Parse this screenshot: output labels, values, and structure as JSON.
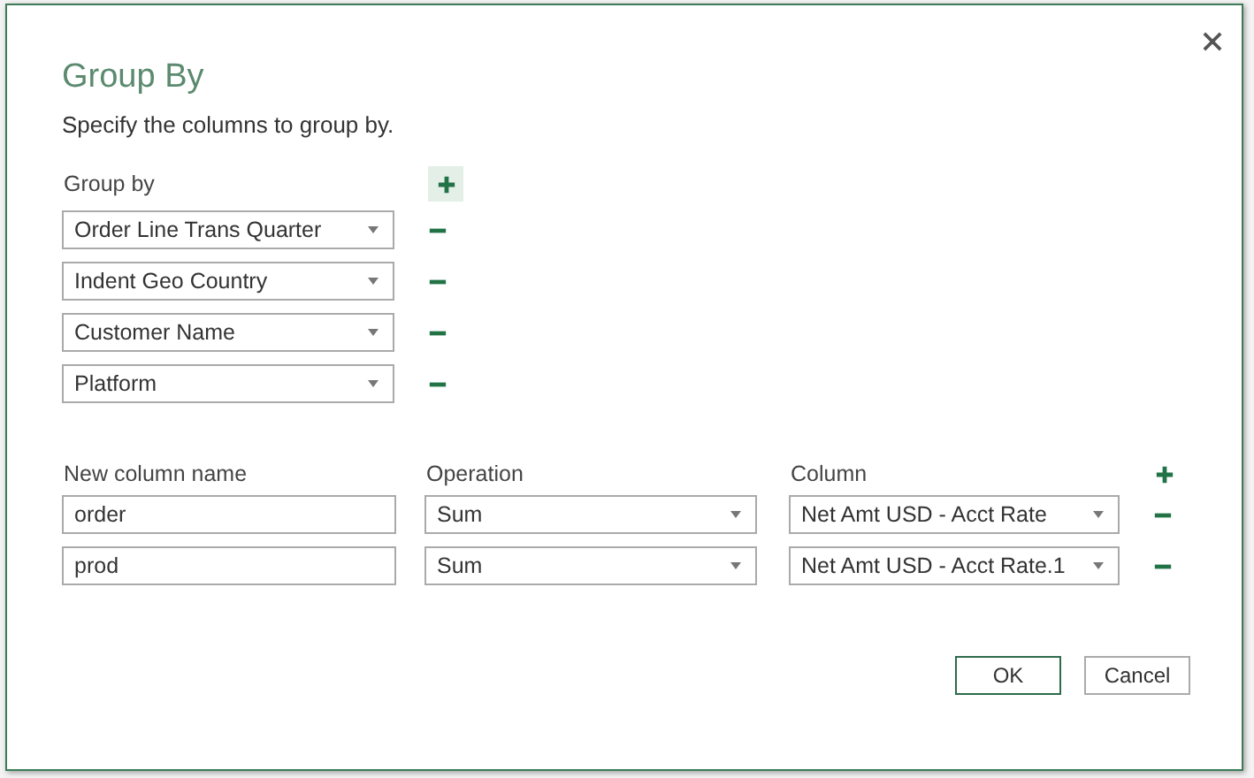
{
  "dialog": {
    "title": "Group By",
    "subtitle": "Specify the columns to group by."
  },
  "group_by": {
    "label": "Group by",
    "fields": [
      {
        "value": "Order Line Trans Quarter"
      },
      {
        "value": "Indent Geo Country"
      },
      {
        "value": "Customer Name"
      },
      {
        "value": "Platform"
      }
    ]
  },
  "aggregations": {
    "columns": [
      "New column name",
      "Operation",
      "Column"
    ],
    "rows": [
      {
        "name": "order",
        "operation": "Sum",
        "column": "Net Amt USD - Acct Rate"
      },
      {
        "name": "prod",
        "operation": "Sum",
        "column": "Net Amt USD - Acct Rate.1"
      }
    ]
  },
  "buttons": [
    {
      "label": "OK",
      "kind": "primary"
    },
    {
      "label": "Cancel",
      "kind": "secondary"
    }
  ]
}
